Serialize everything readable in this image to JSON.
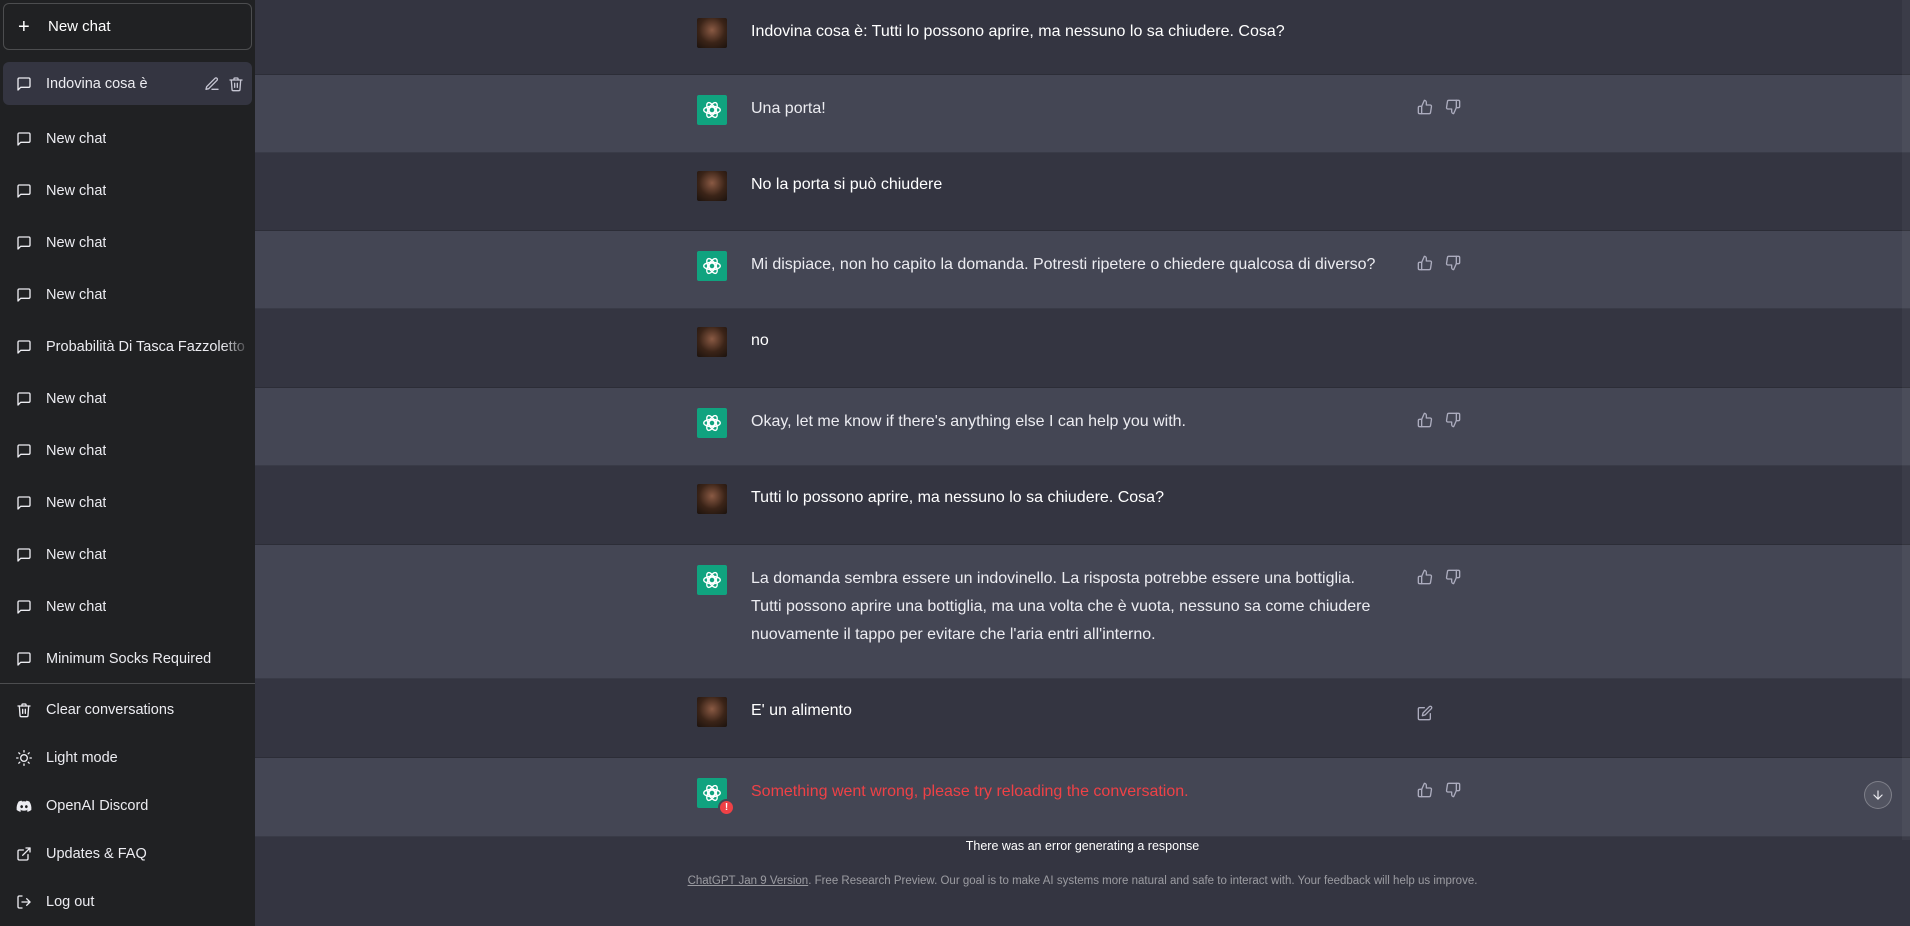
{
  "sidebar": {
    "new_chat_label": "New chat",
    "history": [
      {
        "label": "Indovina cosa è",
        "active": true
      },
      {
        "label": "New chat"
      },
      {
        "label": "New chat"
      },
      {
        "label": "New chat"
      },
      {
        "label": "New chat"
      },
      {
        "label": "Probabilità Di Tasca Fazzoletto"
      },
      {
        "label": "New chat"
      },
      {
        "label": "New chat"
      },
      {
        "label": "New chat"
      },
      {
        "label": "New chat"
      },
      {
        "label": "New chat"
      },
      {
        "label": "Minimum Socks Required"
      }
    ],
    "bottom": {
      "clear": "Clear conversations",
      "light_mode": "Light mode",
      "discord": "OpenAI Discord",
      "faq": "Updates & FAQ",
      "logout": "Log out"
    }
  },
  "messages": [
    {
      "role": "user",
      "text": "Indovina cosa è: Tutti lo possono aprire, ma nessuno lo sa chiudere. Cosa?"
    },
    {
      "role": "bot",
      "text": "Una porta!"
    },
    {
      "role": "user",
      "text": "No la porta si può chiudere"
    },
    {
      "role": "bot",
      "text": "Mi dispiace, non ho capito la domanda. Potresti ripetere o chiedere qualcosa di diverso?"
    },
    {
      "role": "user",
      "text": "no"
    },
    {
      "role": "bot",
      "text": "Okay, let me know if there's anything else I can help you with."
    },
    {
      "role": "user",
      "text": " Tutti lo possono aprire, ma nessuno lo sa chiudere. Cosa?"
    },
    {
      "role": "bot",
      "text": "La domanda sembra essere un indovinello. La risposta potrebbe essere una bottiglia. Tutti possono aprire una bottiglia, ma una volta che è vuota, nessuno sa come chiudere nuovamente il tappo per evitare che l'aria entri all'interno."
    },
    {
      "role": "user",
      "text": "E' un alimento",
      "editable": true
    },
    {
      "role": "bot",
      "text": "Something went wrong, please try reloading the conversation.",
      "error": true
    }
  ],
  "footer": {
    "error": "There was an error generating a response",
    "version_link": "ChatGPT Jan 9 Version",
    "disclaimer": ". Free Research Preview. Our goal is to make AI systems more natural and safe to interact with. Your feedback will help us improve."
  },
  "colors": {
    "sidebar_bg": "#202123",
    "user_row_bg": "#343541",
    "bot_row_bg": "#444654",
    "bot_avatar": "#10a37f",
    "error": "#ef4146"
  }
}
